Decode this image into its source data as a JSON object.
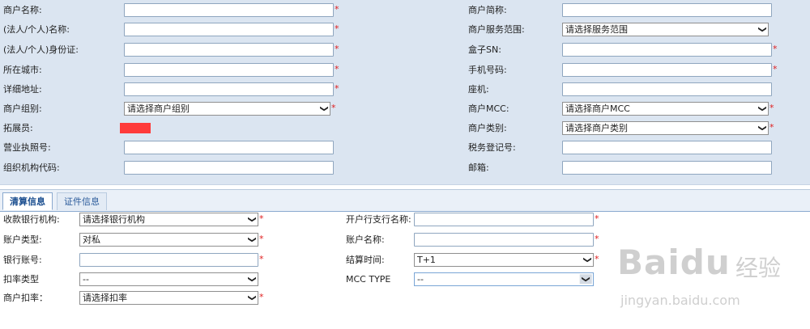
{
  "merchant_form": {
    "left": [
      {
        "label": "商户名称:",
        "type": "input",
        "value": "",
        "required": true
      },
      {
        "label": "(法人/个人)名称:",
        "type": "input",
        "value": "",
        "required": true
      },
      {
        "label": "(法人/个人)身份证:",
        "type": "input",
        "value": "",
        "required": true
      },
      {
        "label": "所在城市:",
        "type": "input",
        "value": "",
        "required": true
      },
      {
        "label": "详细地址:",
        "type": "input",
        "value": "",
        "required": true
      },
      {
        "label": "商户组别:",
        "type": "select",
        "value": "请选择商户组别",
        "required": true
      },
      {
        "label": "拓展员:",
        "type": "redacted"
      },
      {
        "label": "营业执照号:",
        "type": "input",
        "value": "",
        "required": false
      },
      {
        "label": "组织机构代码:",
        "type": "input",
        "value": "",
        "required": false
      }
    ],
    "right": [
      {
        "label": "商户简称:",
        "type": "input",
        "value": "",
        "required": false
      },
      {
        "label": "商户服务范围:",
        "type": "select",
        "value": "请选择服务范围",
        "required": false
      },
      {
        "label": "盒子SN:",
        "type": "input",
        "value": "",
        "required": true
      },
      {
        "label": "手机号码:",
        "type": "input",
        "value": "",
        "required": true
      },
      {
        "label": "座机:",
        "type": "input",
        "value": "",
        "required": false
      },
      {
        "label": "商户MCC:",
        "type": "select",
        "value": "请选择商户MCC",
        "required": true
      },
      {
        "label": "商户类别:",
        "type": "select",
        "value": "请选择商户类别",
        "required": true
      },
      {
        "label": "税务登记号:",
        "type": "input",
        "value": "",
        "required": false
      },
      {
        "label": "邮箱:",
        "type": "input",
        "value": "",
        "required": false
      }
    ]
  },
  "tabs": [
    {
      "label": "清算信息",
      "active": true
    },
    {
      "label": "证件信息",
      "active": false
    }
  ],
  "settlement_form": {
    "left": [
      {
        "label": "收款银行机构:",
        "type": "select",
        "value": "请选择银行机构",
        "required": true
      },
      {
        "label": "账户类型:",
        "type": "select",
        "value": "对私",
        "required": true
      },
      {
        "label": "银行账号:",
        "type": "input",
        "value": "",
        "required": true
      },
      {
        "label": "扣率类型",
        "type": "select",
        "value": "--",
        "required": false
      },
      {
        "label": "商户扣率：",
        "type": "select",
        "value": "请选择扣率",
        "required": true
      }
    ],
    "right": [
      {
        "label": "开户行支行名称:",
        "type": "input",
        "value": "",
        "required": true
      },
      {
        "label": "账户名称:",
        "type": "input",
        "value": "",
        "required": true
      },
      {
        "label": "结算时间:",
        "type": "select",
        "value": "T+1",
        "required": true
      },
      {
        "label": "MCC TYPE",
        "type": "select",
        "value": "--",
        "required": false
      }
    ]
  },
  "required_mark": "*",
  "select_arrow": "chevron-down",
  "watermark": {
    "brand": "Baidu",
    "cn": "经验",
    "url": "jingyan.baidu.com"
  },
  "colors": {
    "panel_bg": "#dbe5f1",
    "required": "#e02020",
    "redaction": "#ff3b3b",
    "tab_active_text": "#1a4d8f"
  }
}
